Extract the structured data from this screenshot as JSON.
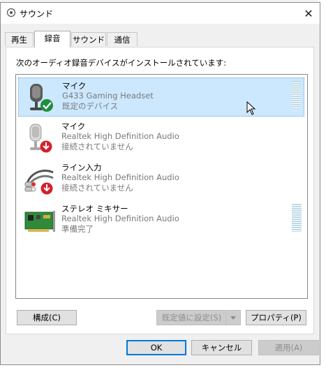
{
  "window": {
    "title": "サウンド",
    "close_symbol": "✕"
  },
  "tabs": [
    {
      "label": "再生"
    },
    {
      "label": "録音"
    },
    {
      "label": "サウンド"
    },
    {
      "label": "通信"
    }
  ],
  "panel": {
    "instruction": "次のオーディオ録音デバイスがインストールされています:"
  },
  "devices": [
    {
      "name": "マイク",
      "description": "G433 Gaming Headset",
      "status": "既定のデバイス",
      "icon": "headset-mic-icon",
      "badge": "check-badge-icon"
    },
    {
      "name": "マイク",
      "description": "Realtek High Definition Audio",
      "status": "接続されていません",
      "icon": "microphone-icon",
      "badge": "disconnected-badge-icon"
    },
    {
      "name": "ライン入力",
      "description": "Realtek High Definition Audio",
      "status": "接続されていません",
      "icon": "line-in-cable-icon",
      "badge": "disconnected-badge-icon"
    },
    {
      "name": "ステレオ ミキサー",
      "description": "Realtek High Definition Audio",
      "status": "準備完了",
      "icon": "sound-card-icon",
      "badge": ""
    }
  ],
  "panel_buttons": {
    "configure": "構成(C)",
    "set_default": "既定値に設定(S)",
    "properties": "プロパティ(P)"
  },
  "dialog_buttons": {
    "ok": "OK",
    "cancel": "キャンセル",
    "apply": "適用(A)"
  },
  "colors": {
    "selection": "#cce8ff",
    "accent": "#0078d7",
    "check_badge": "#1e8e3e",
    "disconnected_badge": "#d4202a"
  }
}
